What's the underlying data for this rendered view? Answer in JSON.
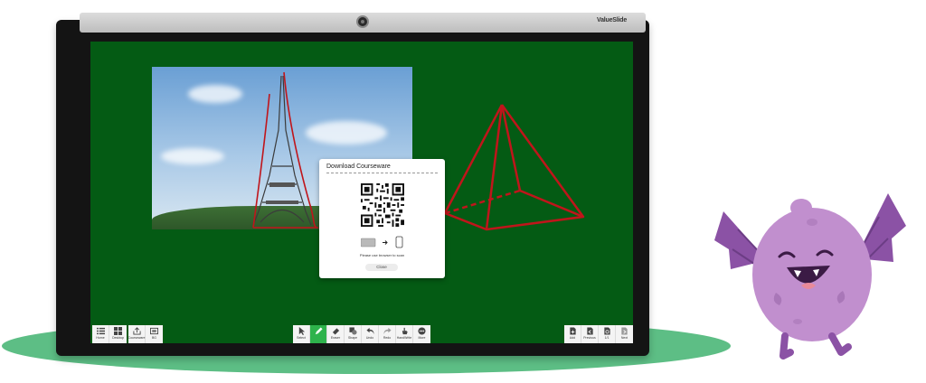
{
  "device": {
    "brand": "ValueSlide"
  },
  "dialog": {
    "title": "Download Courseware",
    "message": "Please use browser to scan",
    "close_label": "Close"
  },
  "toolbar_left": [
    {
      "label": "Home",
      "icon": "list-icon"
    },
    {
      "label": "Desktop",
      "icon": "windows-icon"
    },
    {
      "label": "Courseware",
      "icon": "share-icon"
    },
    {
      "label": "BG",
      "icon": "background-icon"
    }
  ],
  "toolbar_center": [
    {
      "label": "Select",
      "icon": "cursor-icon",
      "active": false
    },
    {
      "label": "",
      "icon": "pen-icon",
      "active": true
    },
    {
      "label": "Eraser",
      "icon": "eraser-icon",
      "active": false
    },
    {
      "label": "Shape",
      "icon": "shape-icon",
      "active": false
    },
    {
      "label": "Undo",
      "icon": "undo-icon",
      "active": false
    },
    {
      "label": "Redo",
      "icon": "redo-icon",
      "active": false
    },
    {
      "label": "HandWrite",
      "icon": "hand-icon",
      "active": false
    },
    {
      "label": "More",
      "icon": "more-icon",
      "active": false
    }
  ],
  "toolbar_right": [
    {
      "label": "Add",
      "icon": "add-page-icon"
    },
    {
      "label": "Previous",
      "icon": "previous-page-icon"
    },
    {
      "label": "1/1",
      "icon": "page-count-icon"
    },
    {
      "label": "Next",
      "icon": "next-page-icon"
    }
  ],
  "colors": {
    "board": "#045b14",
    "ink": "#c0151b",
    "accent": "#2eb34c",
    "monster": "#c18fce",
    "monster_wing": "#8b52a5",
    "floor": "#5dbe85"
  }
}
